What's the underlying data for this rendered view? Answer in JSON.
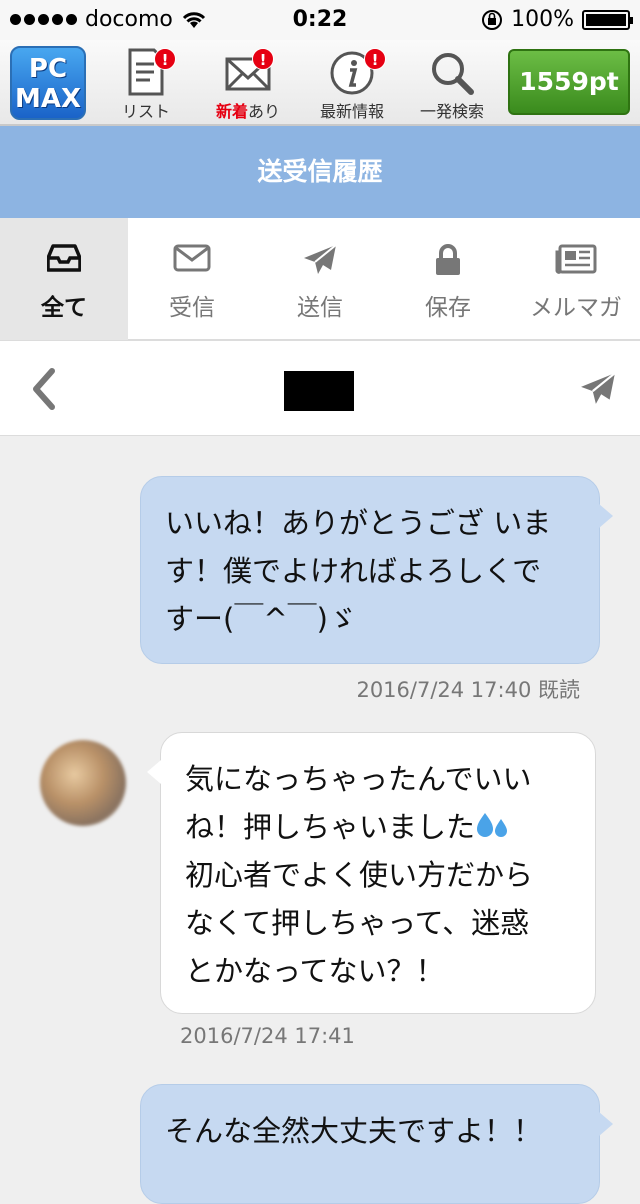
{
  "status_bar": {
    "carrier": "docomo",
    "time": "0:22",
    "battery": "100%"
  },
  "toolbar": {
    "logo_line1": "PC",
    "logo_line2": "MAX",
    "items": [
      {
        "label": "リスト",
        "icon": "list-icon",
        "badge": "!"
      },
      {
        "label_new": "新着",
        "label_rest": "あり",
        "icon": "mail-icon",
        "badge": "!"
      },
      {
        "label": "最新情報",
        "icon": "info-icon",
        "badge": "!"
      },
      {
        "label": "一発検索",
        "icon": "search-icon"
      }
    ],
    "points": "1559pt"
  },
  "page_title": "送受信履歴",
  "tabs": [
    {
      "label": "全て",
      "icon": "inbox-icon",
      "active": true
    },
    {
      "label": "受信",
      "icon": "envelope-icon"
    },
    {
      "label": "送信",
      "icon": "paper-plane-icon"
    },
    {
      "label": "保存",
      "icon": "lock-icon"
    },
    {
      "label": "メルマガ",
      "icon": "newspaper-icon"
    }
  ],
  "messages": [
    {
      "direction": "sent",
      "lines": [
        "いいね！ありがとうござ いま",
        "す！僕でよければよろしくで",
        "すー(￣^￣)ゞ"
      ],
      "meta": "2016/7/24 17:40 既読"
    },
    {
      "direction": "received",
      "lines": [
        "気になっちゃったんでいい",
        "ね！押しちゃいました",
        "初心者でよく使い方だから",
        "なくて押しちゃって、迷惑",
        "とかなってない？！"
      ],
      "meta": "2016/7/24 17:41"
    },
    {
      "direction": "sent",
      "lines": [
        "そんな全然大丈夫ですよ！！"
      ]
    }
  ],
  "colors": {
    "title_band": "#8db4e2",
    "sent_bubble": "#c6d9f1",
    "points_button": "#4a9d2a",
    "badge": "#e60012"
  }
}
